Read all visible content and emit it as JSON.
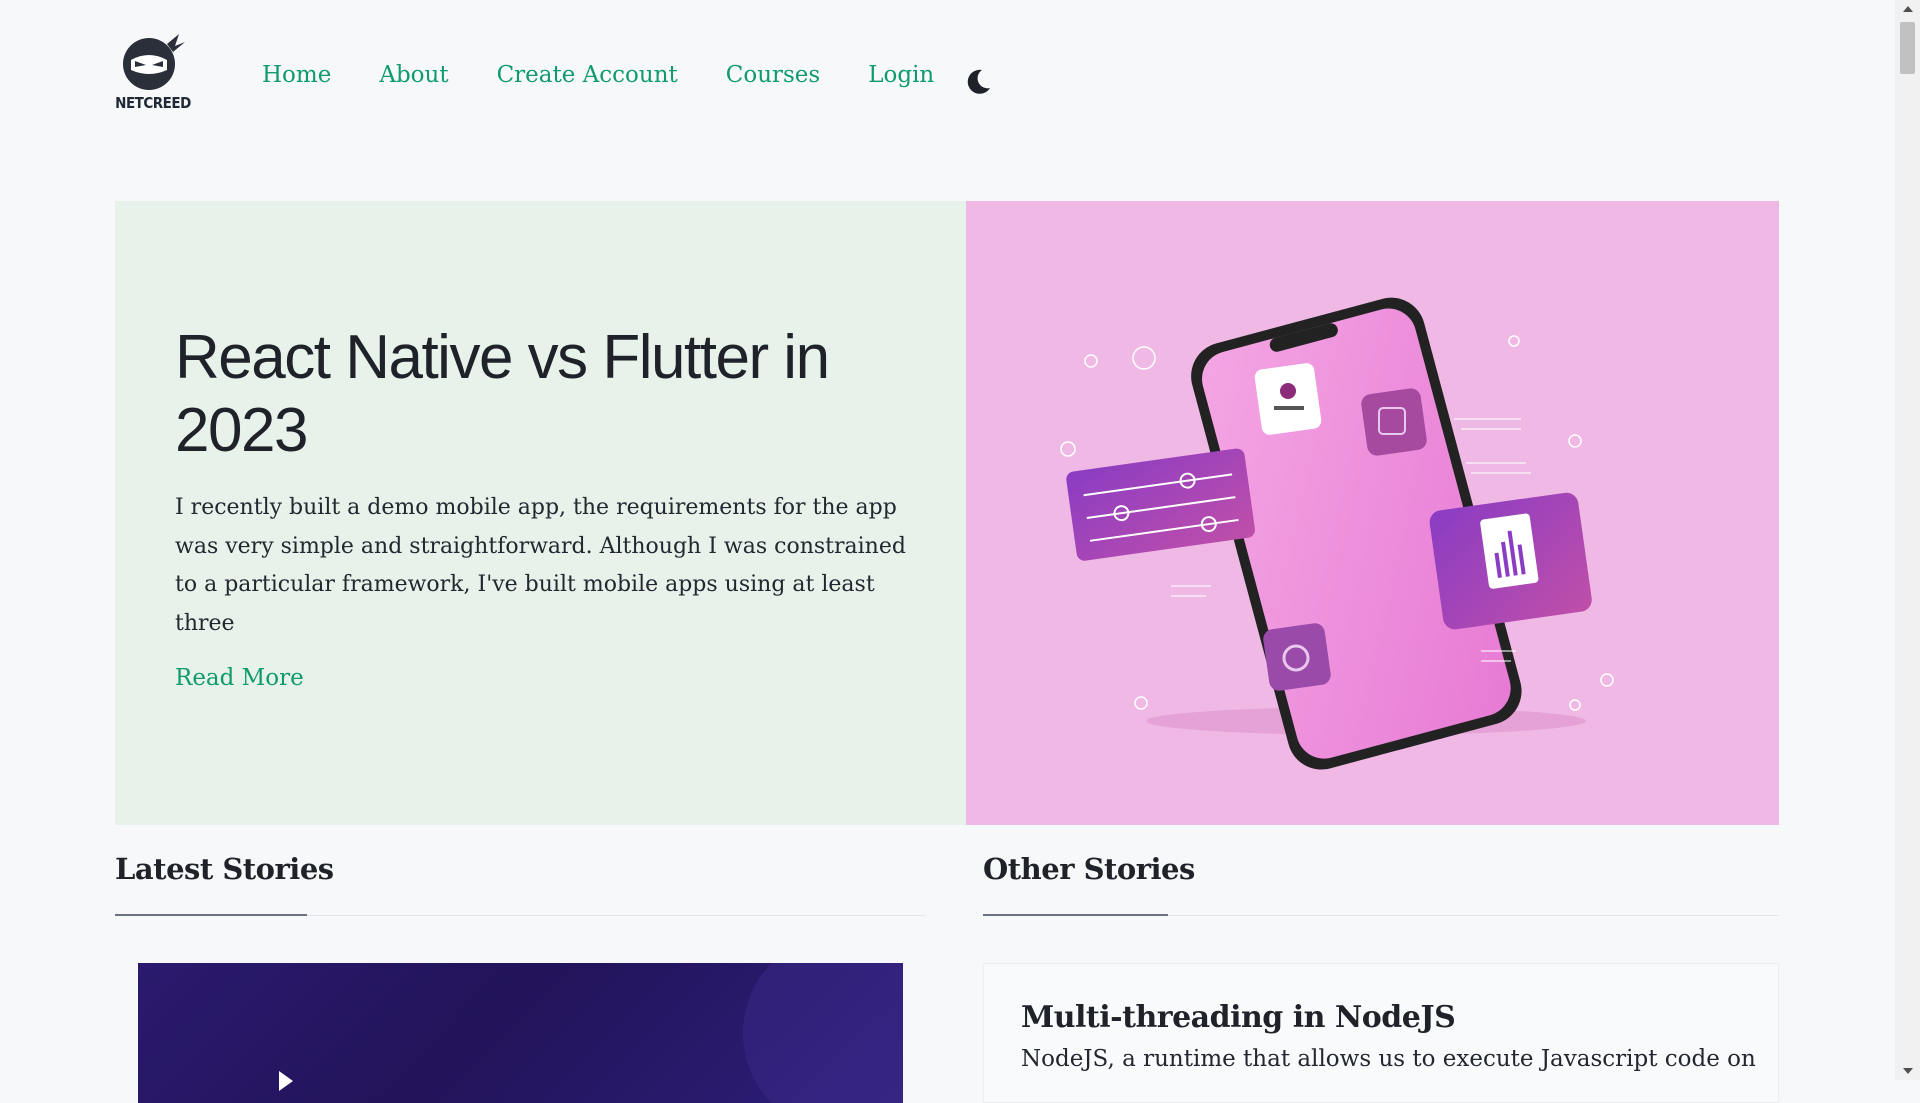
{
  "brand": {
    "name": "NETCREED"
  },
  "nav": {
    "items": [
      {
        "label": "Home"
      },
      {
        "label": "About"
      },
      {
        "label": "Create Account"
      },
      {
        "label": "Courses"
      },
      {
        "label": "Login"
      }
    ],
    "theme_toggle_icon": "moon-icon"
  },
  "hero": {
    "title": "React Native vs Flutter in 2023",
    "description": "I recently built a demo mobile app, the requirements for the app was very simple and straightforward. Although I was constrained to a particular framework, I've built mobile apps using at least three",
    "read_more": "Read More",
    "image_icon": "phone-illustration-icon"
  },
  "sections": {
    "latest": {
      "title": "Latest Stories"
    },
    "other": {
      "title": "Other Stories"
    }
  },
  "other_stories": [
    {
      "title": "Multi-threading in NodeJS",
      "excerpt": "NodeJS, a runtime that allows us to execute Javascript code on"
    }
  ],
  "colors": {
    "accent": "#0f9b6e",
    "hero_left_bg": "#e6f2ea",
    "hero_right_bg": "#f0b9e5",
    "page_bg": "#f7f8fa"
  }
}
